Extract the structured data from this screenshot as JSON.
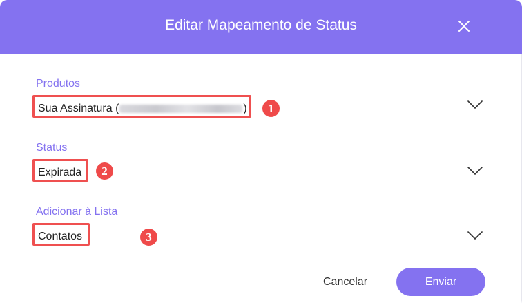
{
  "dialog": {
    "title": "Editar Mapeamento de Status",
    "close_icon": "close-icon"
  },
  "fields": [
    {
      "label": "Produtos",
      "value_prefix": "Sua Assinatura (",
      "value_suffix": ")",
      "badge": "1"
    },
    {
      "label": "Status",
      "value": "Expirada",
      "badge": "2"
    },
    {
      "label": "Adicionar à Lista",
      "value": "Contatos",
      "badge": "3"
    }
  ],
  "footer": {
    "cancel_label": "Cancelar",
    "submit_label": "Enviar"
  },
  "colors": {
    "header": "#8472f0",
    "accent": "#8472f0",
    "highlight": "#ef5050"
  }
}
